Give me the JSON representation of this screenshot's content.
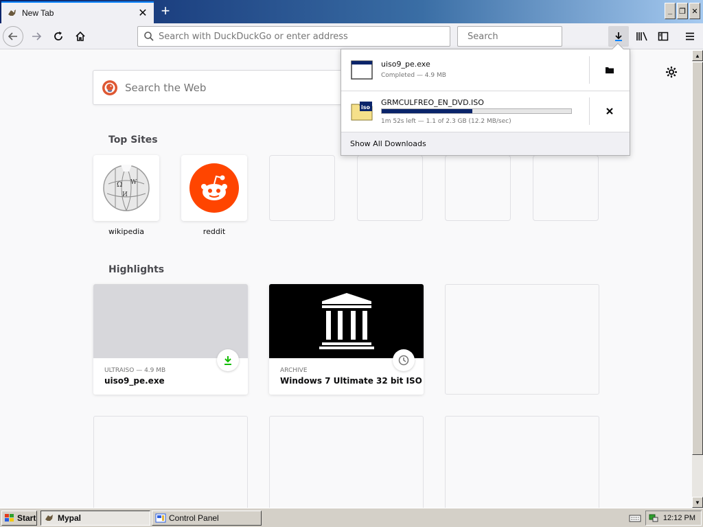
{
  "browser": {
    "tab_title": "New Tab",
    "url_placeholder": "Search with DuckDuckGo or enter address",
    "search_placeholder": "Search"
  },
  "newtab": {
    "websearch_placeholder": "Search the Web",
    "top_sites_title": "Top Sites",
    "top_sites": [
      {
        "label": "wikipedia"
      },
      {
        "label": "reddit"
      }
    ],
    "highlights_title": "Highlights",
    "highlights": [
      {
        "context": "ULTRAISO — 4.9 MB",
        "title": "uiso9_pe.exe"
      },
      {
        "context": "ARCHIVE",
        "title": "Windows 7 Ultimate 32 bit ISO (..."
      }
    ]
  },
  "downloads": {
    "items": [
      {
        "name": "uiso9_pe.exe",
        "status": "Completed — 4.9 MB"
      },
      {
        "name": "GRMCULFREO_EN_DVD.ISO",
        "status": "1m 52s left — 1.1 of 2.3 GB (12.2 MB/sec)",
        "progress": 0.48
      }
    ],
    "show_all": "Show All Downloads"
  },
  "taskbar": {
    "start": "Start",
    "tasks": [
      {
        "label": "Mypal"
      },
      {
        "label": "Control Panel"
      }
    ],
    "clock": "12:12 PM"
  },
  "colors": {
    "accent": "#0a84ff",
    "reddit": "#ff4500",
    "progress": "#0a246a",
    "download_green": "#12bc00"
  }
}
